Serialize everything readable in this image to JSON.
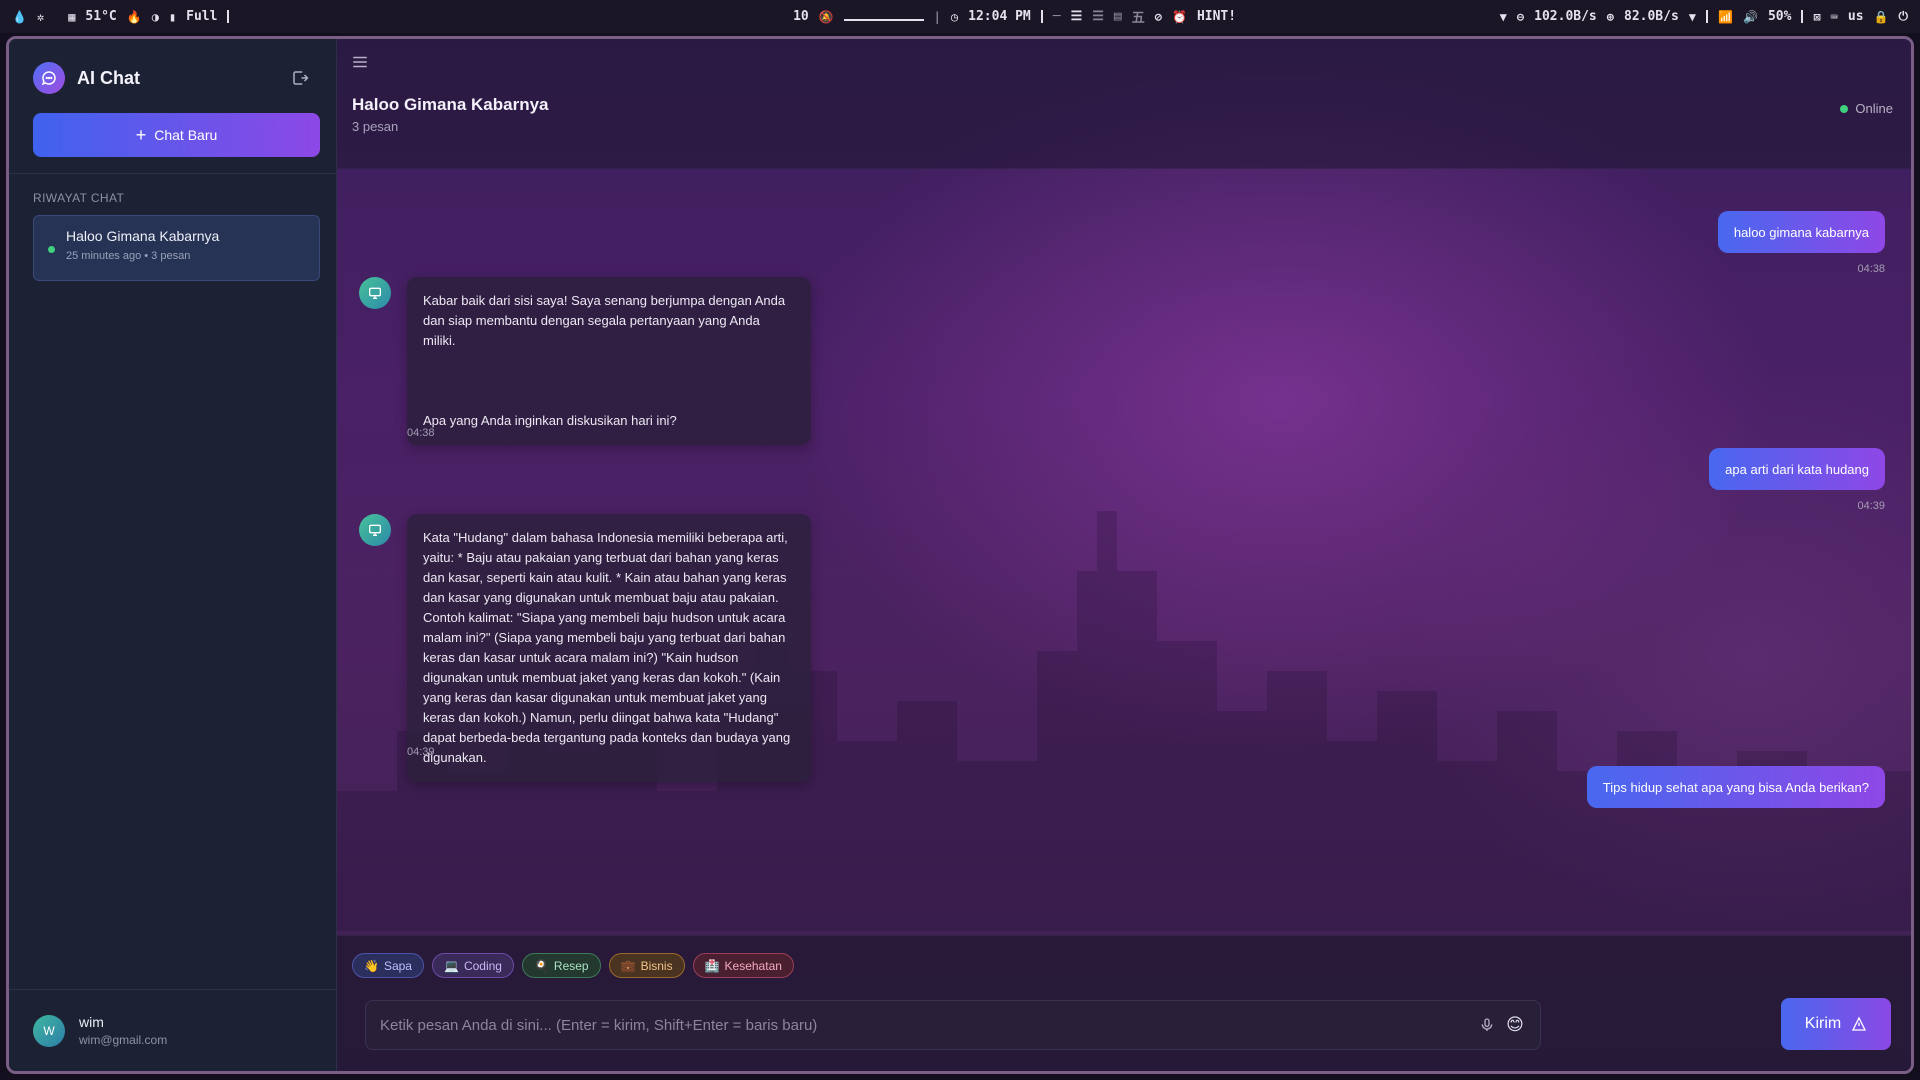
{
  "statusbar": {
    "temp": "51°C",
    "power": "Full",
    "workspaces": "10",
    "clock": "12:04 PM",
    "hint": "HINT!",
    "net_down": "102.0B/s",
    "net_up": "82.0B/s",
    "volume": "50%",
    "keyboard": "us"
  },
  "sidebar": {
    "app_title": "AI Chat",
    "new_chat_label": "Chat Baru",
    "history_label": "RIWAYAT CHAT",
    "history": [
      {
        "title": "Haloo Gimana Kabarnya",
        "meta": "25 minutes ago • 3 pesan"
      }
    ],
    "user": {
      "initial": "W",
      "name": "wim",
      "email": "wim@gmail.com"
    }
  },
  "chat": {
    "title": "Haloo Gimana Kabarnya",
    "subtitle": "3 pesan",
    "status": "Online",
    "messages": [
      {
        "role": "user",
        "text": "haloo gimana kabarnya",
        "time": "04:38"
      },
      {
        "role": "bot",
        "paragraphs": [
          "Kabar baik dari sisi saya! Saya senang berjumpa dengan Anda dan siap membantu dengan segala pertanyaan yang Anda miliki.",
          "Apa yang Anda inginkan diskusikan hari ini?"
        ],
        "time": "04:38"
      },
      {
        "role": "user",
        "text": "apa arti dari kata hudang",
        "time": "04:39"
      },
      {
        "role": "bot",
        "paragraphs": [
          "Kata \"Hudang\" dalam bahasa Indonesia memiliki beberapa arti, yaitu: * Baju atau pakaian yang terbuat dari bahan yang keras dan kasar, seperti kain atau kulit. * Kain atau bahan yang keras dan kasar yang digunakan untuk membuat baju atau pakaian. Contoh kalimat: \"Siapa yang membeli baju hudson untuk acara malam ini?\" (Siapa yang membeli baju yang terbuat dari bahan keras dan kasar untuk acara malam ini?) \"Kain hudson digunakan untuk membuat jaket yang keras dan kokoh.\" (Kain yang keras dan kasar digunakan untuk membuat jaket yang keras dan kokoh.) Namun, perlu diingat bahwa kata \"Hudang\" dapat berbeda-beda tergantung pada konteks dan budaya yang digunakan."
        ],
        "time": "04:39"
      },
      {
        "role": "user",
        "text": "Tips hidup sehat apa yang bisa Anda berikan?"
      }
    ]
  },
  "chips": [
    {
      "emoji": "👋",
      "label": "Sapa"
    },
    {
      "emoji": "💻",
      "label": "Coding"
    },
    {
      "emoji": "🍳",
      "label": "Resep"
    },
    {
      "emoji": "💼",
      "label": "Bisnis"
    },
    {
      "emoji": "🏥",
      "label": "Kesehatan"
    }
  ],
  "composer": {
    "placeholder": "Ketik pesan Anda di sini... (Enter = kirim, Shift+Enter = baris baru)",
    "send_label": "Kirim"
  },
  "colors": {
    "accent_start": "#4868ef",
    "accent_end": "#8f47e6",
    "online": "#3fd17e"
  }
}
